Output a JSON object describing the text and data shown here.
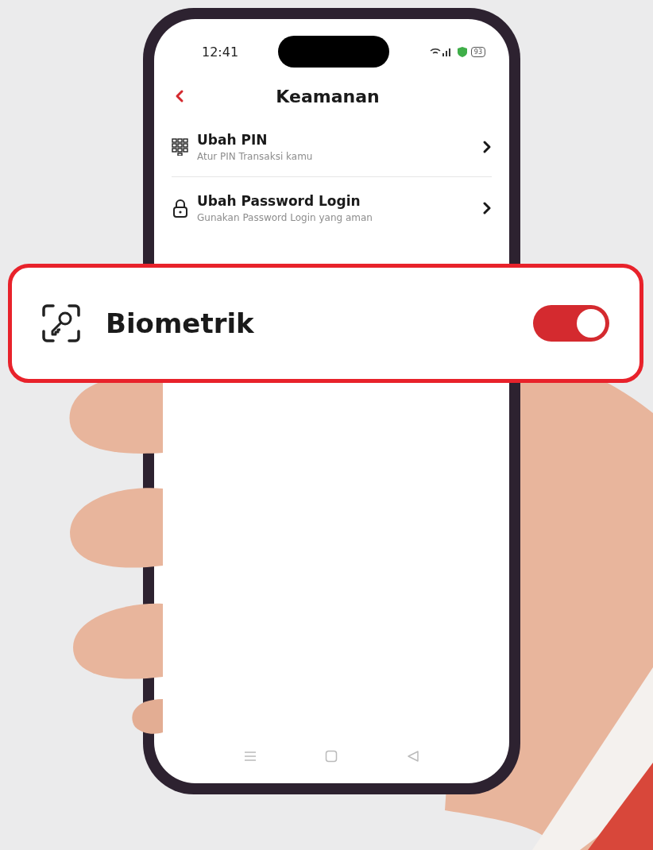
{
  "status_bar": {
    "time": "12:41",
    "battery": "93"
  },
  "header": {
    "title": "Keamanan"
  },
  "menu_items": [
    {
      "kind": "keypad",
      "title": "Ubah PIN",
      "subtitle": "Atur PIN Transaksi kamu"
    },
    {
      "kind": "lock",
      "title": "Ubah Password Login",
      "subtitle": "Gunakan Password Login yang aman"
    }
  ],
  "highlight": {
    "kind": "biometric",
    "label": "Biometrik",
    "on": true
  }
}
